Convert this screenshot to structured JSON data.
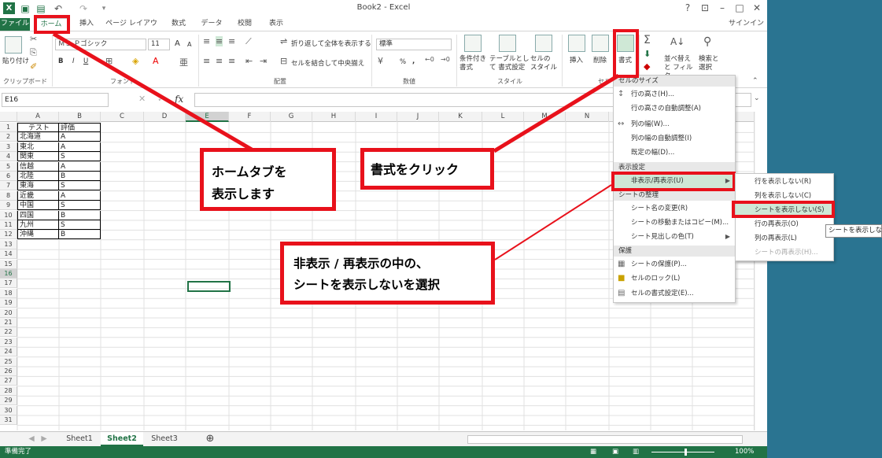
{
  "title_bar": {
    "title": "Book2 - Excel",
    "undo_icon": "undo-icon",
    "redo_icon": "redo-icon"
  },
  "tabs": [
    "ファイル",
    "ホーム",
    "挿入",
    "ページ レイアウト",
    "数式",
    "データ",
    "校閲",
    "表示"
  ],
  "sign_in": "サインイン",
  "ribbon": {
    "clipboard": {
      "paste": "貼り付け",
      "group": "クリップボード"
    },
    "font": {
      "name": "ＭＳ Ｐゴシック",
      "size": "11",
      "grow": "A",
      "shrink": "A",
      "bold": "B",
      "italic": "I",
      "underline": "U",
      "group": "フォント"
    },
    "alignment": {
      "wrap": "折り返して全体を表示する",
      "merge": "セルを結合して中央揃え",
      "group": "配置"
    },
    "number": {
      "format": "標準",
      "percent": "%",
      "comma": ",",
      "group": "数値"
    },
    "styles": {
      "conditional": "条件付き 書式",
      "table": "テーブルとして 書式設定",
      "cell": "セルの スタイル",
      "group": "スタイル"
    },
    "cells": {
      "insert": "挿入",
      "delete": "削除",
      "format": "書式",
      "group": "セル"
    },
    "editing": {
      "sort": "並べ替えと フィルター",
      "find": "検索と 選択"
    }
  },
  "formula_bar": {
    "name_box": "E16",
    "fx": "fx"
  },
  "columns": [
    "A",
    "B",
    "C",
    "D",
    "E",
    "F",
    "G",
    "H",
    "I",
    "J",
    "K",
    "L",
    "M",
    "N"
  ],
  "rows": [
    "1",
    "2",
    "3",
    "4",
    "5",
    "6",
    "7",
    "8",
    "9",
    "10",
    "11",
    "12",
    "13",
    "14",
    "15",
    "16",
    "17",
    "18",
    "19",
    "20",
    "21",
    "22",
    "23",
    "24",
    "25",
    "26",
    "27",
    "28",
    "29",
    "30",
    "31"
  ],
  "table": {
    "header": [
      "テスト",
      "評価"
    ],
    "data": [
      [
        "北海道",
        "A"
      ],
      [
        "東北",
        "A"
      ],
      [
        "関東",
        "S"
      ],
      [
        "信越",
        "A"
      ],
      [
        "北陸",
        "B"
      ],
      [
        "東海",
        "S"
      ],
      [
        "近畿",
        "A"
      ],
      [
        "中国",
        "S"
      ],
      [
        "四国",
        "B"
      ],
      [
        "九州",
        "S"
      ],
      [
        "沖縄",
        "B"
      ]
    ]
  },
  "sheets": [
    "Sheet1",
    "Sheet2",
    "Sheet3"
  ],
  "active_sheet": "Sheet2",
  "status": {
    "ready": "準備完了",
    "zoom": "100%"
  },
  "format_menu": {
    "sections": [
      "セルのサイズ",
      "表示設定",
      "シートの整理",
      "保護"
    ],
    "size_items": [
      "行の高さ(H)...",
      "行の高さの自動調整(A)",
      "列の幅(W)...",
      "列の幅の自動調整(I)",
      "既定の幅(D)..."
    ],
    "visibility_items": [
      "非表示/再表示(U)"
    ],
    "organize_items": [
      "シート名の変更(R)",
      "シートの移動またはコピー(M)...",
      "シート見出しの色(T)"
    ],
    "protect_items": [
      "シートの保護(P)...",
      "セルのロック(L)",
      "セルの書式設定(E)..."
    ]
  },
  "submenu": {
    "items": [
      "行を表示しない(R)",
      "列を表示しない(C)",
      "シートを表示しない(S)",
      "行の再表示(O)",
      "列の再表示(L)",
      "シートの再表示(H)..."
    ]
  },
  "tooltip": "シートを表示しない",
  "callouts": {
    "home_tab": [
      "ホームタブを",
      "表示します"
    ],
    "format": "書式をクリック",
    "hide_sheet": [
      "非表示 / 再表示の中の、",
      "シートを表示しないを選択"
    ]
  },
  "accent": "#217346",
  "annotation_color": "#e8111b"
}
